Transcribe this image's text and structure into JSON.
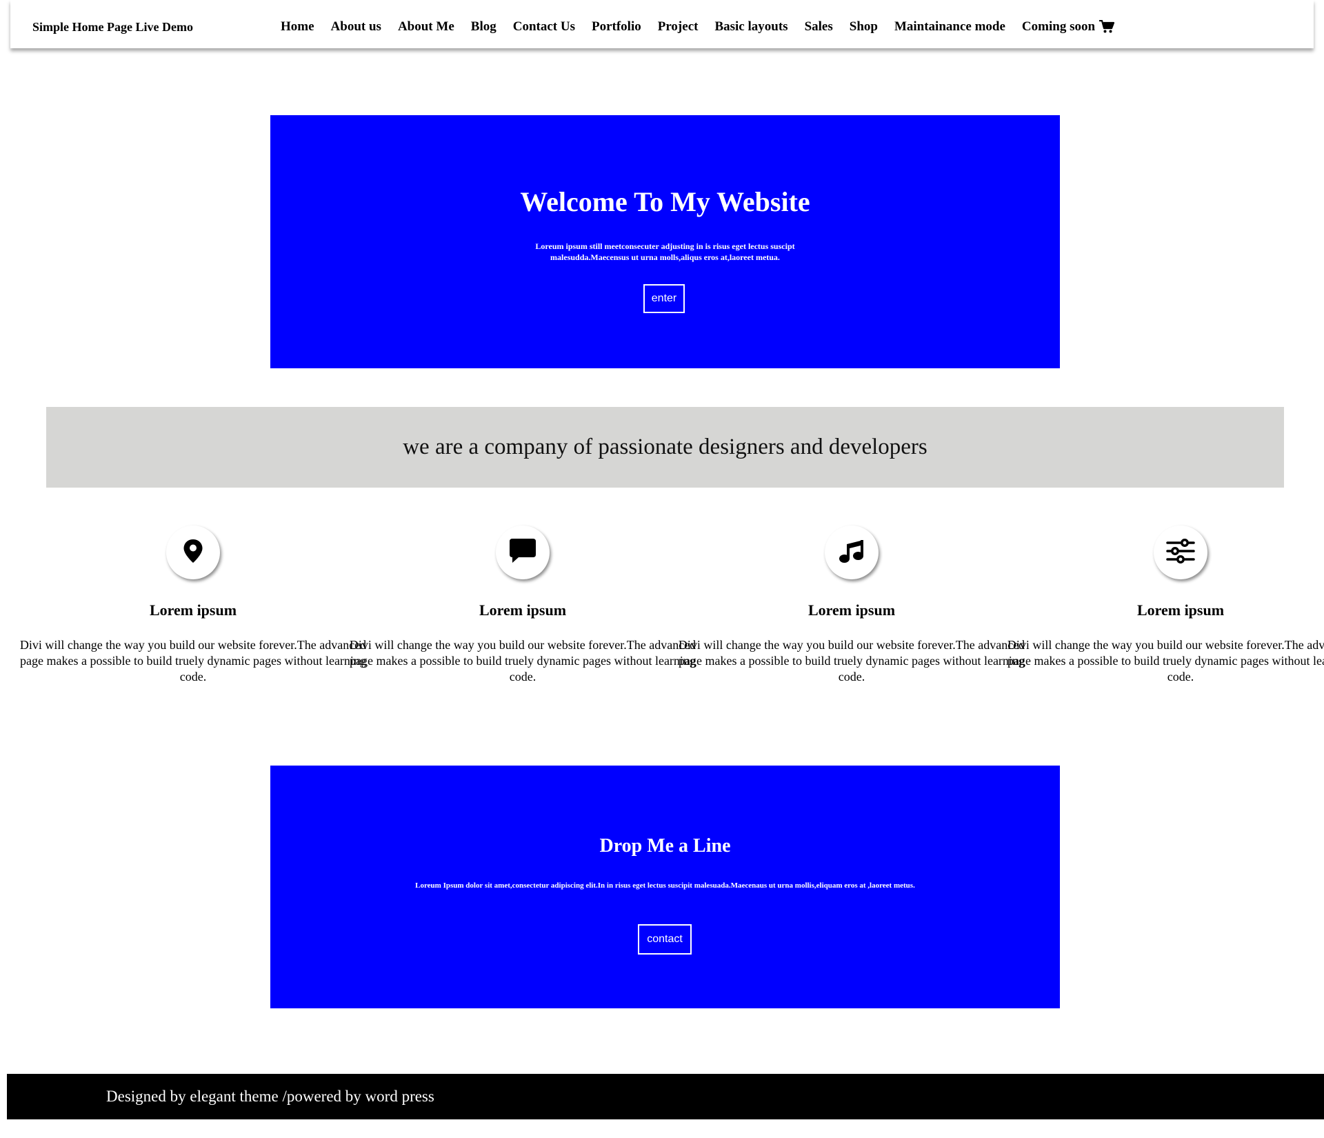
{
  "header": {
    "brand": "Simple Home Page Live Demo",
    "nav": [
      "Home",
      "About us",
      "About Me",
      "Blog",
      "Contact Us",
      "Portfolio",
      "Project",
      "Basic layouts",
      "Sales",
      "Shop",
      "Maintainance mode",
      "Coming soon"
    ],
    "cart_icon": "shopping-cart-icon"
  },
  "hero": {
    "title": "Welcome To My Website",
    "text": "Loreum ipsum still meetconsecuter adjusting in is risus eget lectus suscipt malesudda.Maecensus ut urna molls,aliqus eros at,laoreet metua.",
    "button": "enter",
    "background": "#0000ff"
  },
  "banner": {
    "text": "we are a company of passionate designers and developers",
    "background": "#d6d6d4"
  },
  "features": [
    {
      "icon": "map-pin-icon",
      "title": "Lorem ipsum",
      "text": "Divi will change the way you build our website forever.The advanced page makes a possible to build truely dynamic pages without learning code."
    },
    {
      "icon": "chat-bubble-icon",
      "title": "Lorem ipsum",
      "text": "Divi will change the way you build our website forever.The advanced page makes a possible to build truely dynamic pages without learning code."
    },
    {
      "icon": "music-note-icon",
      "title": "Lorem ipsum",
      "text": "Divi will change the way you build our website forever.The advanced page makes a possible to build truely dynamic pages without learning code."
    },
    {
      "icon": "sliders-icon",
      "title": "Lorem ipsum",
      "text": "Divi will change the way you build our website forever.The advanced page makes a possible to build truely dynamic pages without learning code."
    }
  ],
  "contact": {
    "title": "Drop Me a Line",
    "text": "Loreum Ipsum dolor sit amet,consectetur adipiscing elit.In in risus eget lectus suscipit malesuada.Maecenaus ut urna mollis,eliquam eros at ,laoreet metus.",
    "button": "contact",
    "background": "#0000ff"
  },
  "footer": {
    "text": "Designed by elegant theme /powered by word press",
    "background": "#000000"
  }
}
